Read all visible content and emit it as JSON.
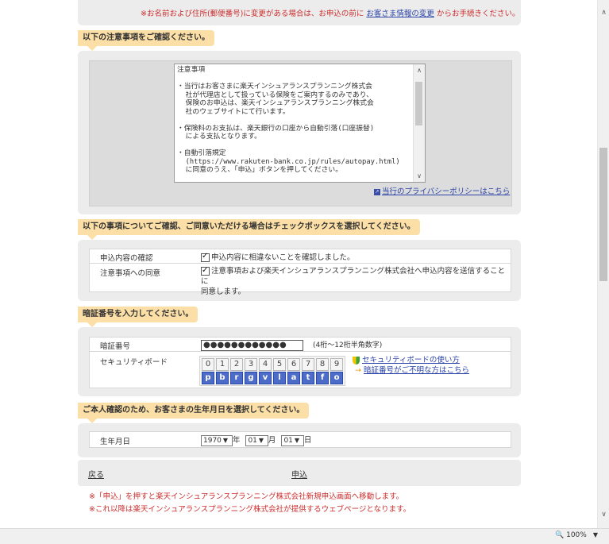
{
  "top_note": {
    "before": "※お名前および住所(郵便番号)に変更がある場合は、お申込の前に ",
    "link": "お客さま情報の変更",
    "after": " からお手続きください。"
  },
  "notice_section": {
    "heading": "以下の注意事項をご確認ください。",
    "text": "注意事項\n\n・当行はお客さまに楽天インシュアランスプランニング株式会\n  社が代理店として扱っている保険をご案内するのみであり、\n  保険のお申込は、楽天インシュアランスプランニング株式会\n  社のウェブサイトにて行います。\n\n・保険料のお支払は、楽天銀行の口座から自動引落(口座振替)\n  による支払となります。\n\n・自動引落規定\n  (https://www.rakuten-bank.co.jp/rules/autopay.html)\n  に同意のうえ、「申込」ボタンを押してください。\n\n・保険料を楽天スーパーポイントでお支払するためには、ハッ",
    "privacy_link": "当行のプライバシーポリシーはこちら"
  },
  "consent_section": {
    "heading": "以下の事項についてご確認、ご同意いただける場合はチェックボックスを選択してください。",
    "rows": [
      {
        "label": "申込内容の確認",
        "text": "申込内容に相違ないことを確認しました。",
        "checked": true
      },
      {
        "label": "注意事項への同意",
        "text": "注意事項および楽天インシュアランスプランニング株式会社へ申込内容を送信することに",
        "text2": "同意します。",
        "checked": true
      }
    ]
  },
  "pin_section": {
    "heading": "暗証番号を入力してください。",
    "pin_label": "暗証番号",
    "pin_value": "●●●●●●●●●●●●",
    "pin_hint": "(4桁～12桁半角数字)",
    "keyboard_label": "セキュリティボード",
    "keys_numbers": [
      "0",
      "1",
      "2",
      "3",
      "4",
      "5",
      "6",
      "7",
      "8",
      "9"
    ],
    "keys_letters": [
      "p",
      "b",
      "r",
      "g",
      "v",
      "l",
      "a",
      "t",
      "f",
      "o"
    ],
    "help_link": "セキュリティボードの使い方",
    "forgot_link": "暗証番号がご不明な方はこちら"
  },
  "birth_section": {
    "heading": "ご本人確認のため、お客さまの生年月日を選択してください。",
    "label": "生年月日",
    "year": "1970",
    "year_unit": "年",
    "month": "01",
    "month_unit": "月",
    "day": "01",
    "day_unit": "日"
  },
  "actions": {
    "back": "戻る",
    "apply": "申込"
  },
  "footer_notes": [
    "※「申込」を押すと楽天インシュアランスプランニング株式会社新規申込画面へ移動します。",
    "※これ以降は楽天インシュアランスプランニング株式会社が提供するウェブページとなります。"
  ],
  "status": {
    "zoom": "100%"
  }
}
